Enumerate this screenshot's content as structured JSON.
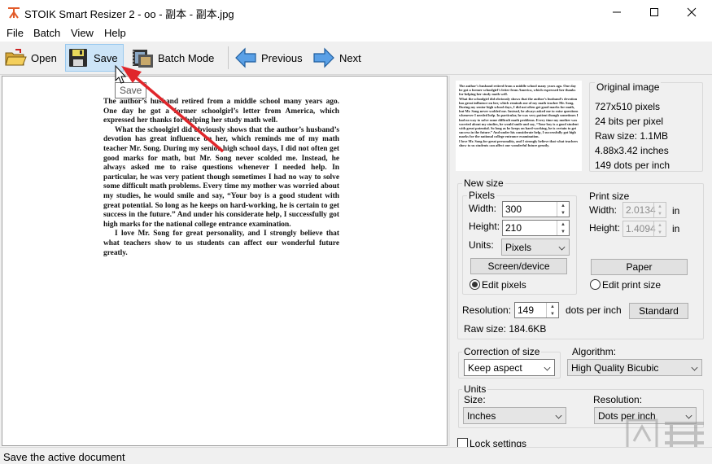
{
  "window": {
    "title": "STOIK Smart Resizer 2 - oo - 副本 - 副本.jpg",
    "minimize_icon": "minimize-icon",
    "maximize_icon": "maximize-icon",
    "close_icon": "close-icon"
  },
  "menu": [
    "File",
    "Batch",
    "View",
    "Help"
  ],
  "toolbar": {
    "open_label": "Open",
    "save_label": "Save",
    "batch_label": "Batch Mode",
    "previous_label": "Previous",
    "next_label": "Next"
  },
  "tooltip": "Save",
  "document_text": [
    "The author’s husband retired from a middle school many years ago. One day he got a former schoolgirl’s letter from America, which expressed her thanks for helping her study math well.",
    "What the schoolgirl did obviously shows that the author’s husband’s devotion has great influence on her, which reminds me of my math teacher Mr. Song. During my senior high school days, I did not often get good marks for math, but Mr. Song never scolded me. Instead, he always asked me to raise questions whenever I needed help. In particular, he was very patient though sometimes I had no way to solve some difficult math problems. Every time my mother was worried about my studies, he would smile and say, “Your boy is a good student with great potential. So long as he keeps on hard-working, he is certain to get success in the future.” And under his considerate help, I successfully got high marks for the national college entrance examination.",
    "I love Mr. Song for great personality, and I strongly believe that what teachers show to us students can affect our wonderful future greatly."
  ],
  "original_image": {
    "title": "Original image",
    "pixels": "727x510 pixels",
    "bits": "24 bits per pixel",
    "raw_size": "Raw size: 1.1MB",
    "inches": "4.88x3.42 inches",
    "dpi": "149 dots per inch"
  },
  "new_size": {
    "title": "New size",
    "pixels_title": "Pixels",
    "width_label": "Width:",
    "width_value": "300",
    "height_label": "Height:",
    "height_value": "210",
    "units_label": "Units:",
    "units_value": "Pixels",
    "screen_button": "Screen/device",
    "edit_pixels_label": "Edit pixels",
    "print_title": "Print size",
    "print_width_label": "Width:",
    "print_width_value": "2.0134",
    "print_height_label": "Height:",
    "print_height_value": "1.4094",
    "in_label_1": "in",
    "in_label_2": "in",
    "paper_button": "Paper",
    "edit_print_label": "Edit print size",
    "resolution_label": "Resolution:",
    "resolution_value": "149",
    "dpi_label": "dots per inch",
    "standard_button": "Standard",
    "raw_size": "Raw size: 184.6KB"
  },
  "correction": {
    "title": "Correction of size",
    "value": "Keep aspect"
  },
  "algorithm": {
    "title": "Algorithm:",
    "value": "High Quality Bicubic"
  },
  "units": {
    "title": "Units",
    "size_label": "Size:",
    "size_value": "Inches",
    "resolution_label": "Resolution:",
    "resolution_value": "Dots per inch"
  },
  "lock_label": "Lock settings",
  "status": "Save the active document",
  "colors": {
    "accent_arrow": "#e0262b",
    "nav_arrow": "#2f7fd6"
  }
}
